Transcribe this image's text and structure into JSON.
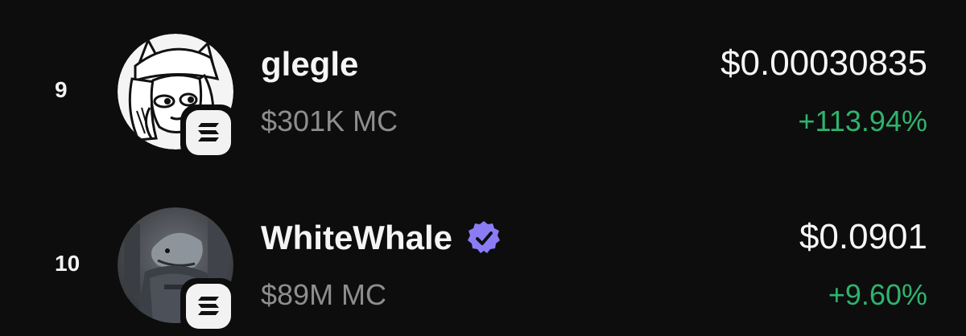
{
  "tokens": [
    {
      "rank": "9",
      "name": "glegle",
      "market_cap": "$301K MC",
      "price": "$0.00030835",
      "change": "+113.94%",
      "verified": false,
      "chain_icon": "solana-icon",
      "avatar_icon": "cartoon-girl-avatar"
    },
    {
      "rank": "10",
      "name": "WhiteWhale",
      "market_cap": "$89M MC",
      "price": "$0.0901",
      "change": "+9.60%",
      "verified": true,
      "chain_icon": "solana-icon",
      "avatar_icon": "whale-warrior-avatar"
    }
  ],
  "colors": {
    "background": "#0d0d0d",
    "primary_text": "#f5f5f5",
    "secondary_text": "#8e8e8e",
    "positive_change": "#2fb36e",
    "verified_badge": "#8b7cf6"
  }
}
